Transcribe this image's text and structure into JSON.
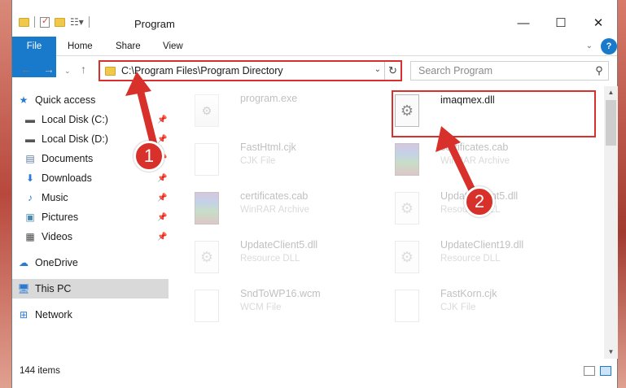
{
  "window": {
    "title": "Program",
    "minimize": "—",
    "maximize": "☐",
    "close": "✕"
  },
  "ribbon": {
    "tabs": [
      "File",
      "Home",
      "Share",
      "View"
    ],
    "help": "?"
  },
  "address_bar": {
    "path": "C:\\Program Files\\Program Directory",
    "dropdown": "⌄",
    "refresh": "↻"
  },
  "search": {
    "placeholder": "Search Program",
    "icon": "search-icon"
  },
  "nav_pane": {
    "items": [
      {
        "label": "Quick access",
        "icon": "star-icon",
        "pinned": false
      },
      {
        "label": "Local Disk (C:)",
        "icon": "drive-icon",
        "pinned": true
      },
      {
        "label": "Local Disk (D:)",
        "icon": "drive-icon",
        "pinned": true
      },
      {
        "label": "Documents",
        "icon": "documents-icon",
        "pinned": true
      },
      {
        "label": "Downloads",
        "icon": "download-icon",
        "pinned": true
      },
      {
        "label": "Music",
        "icon": "music-icon",
        "pinned": true
      },
      {
        "label": "Pictures",
        "icon": "pictures-icon",
        "pinned": true
      },
      {
        "label": "Videos",
        "icon": "videos-icon",
        "pinned": true
      },
      {
        "label": "OneDrive",
        "icon": "cloud-icon",
        "pinned": false
      },
      {
        "label": "This PC",
        "icon": "computer-icon",
        "pinned": false,
        "selected": true
      },
      {
        "label": "Network",
        "icon": "network-icon",
        "pinned": false
      }
    ]
  },
  "files": [
    {
      "name": "program.exe",
      "type": "",
      "icon": "exe-icon",
      "faded": true
    },
    {
      "name": "imaqmex.dll",
      "type": "",
      "icon": "dll-icon",
      "faded": false,
      "highlighted": true
    },
    {
      "name": "FastHtml.cjk",
      "type": "CJK File",
      "icon": "document-icon",
      "faded": true
    },
    {
      "name": "certificates.cab",
      "type": "WinRAR Archive",
      "icon": "winrar-icon",
      "faded": true
    },
    {
      "name": "certificates.cab",
      "type": "WinRAR Archive",
      "icon": "winrar-icon",
      "faded": true
    },
    {
      "name": "UpdateClient5.dll",
      "type": "Resource DLL",
      "icon": "dll-icon",
      "faded": true
    },
    {
      "name": "UpdateClient5.dll",
      "type": "Resource DLL",
      "icon": "dll-icon",
      "faded": true
    },
    {
      "name": "UpdateClient19.dll",
      "type": "Resource DLL",
      "icon": "dll-icon",
      "faded": true
    },
    {
      "name": "SndToWP16.wcm",
      "type": "WCM File",
      "icon": "document-icon",
      "faded": true
    },
    {
      "name": "FastKorn.cjk",
      "type": "CJK File",
      "icon": "document-icon",
      "faded": true
    }
  ],
  "annotations": {
    "step1": "1",
    "step2": "2",
    "accent": "#d8302a"
  },
  "status_bar": {
    "item_count": "144 items"
  },
  "colors": {
    "file_tab": "#1979ca",
    "selection": "#d9d9d9",
    "highlight": "#d8302a"
  }
}
